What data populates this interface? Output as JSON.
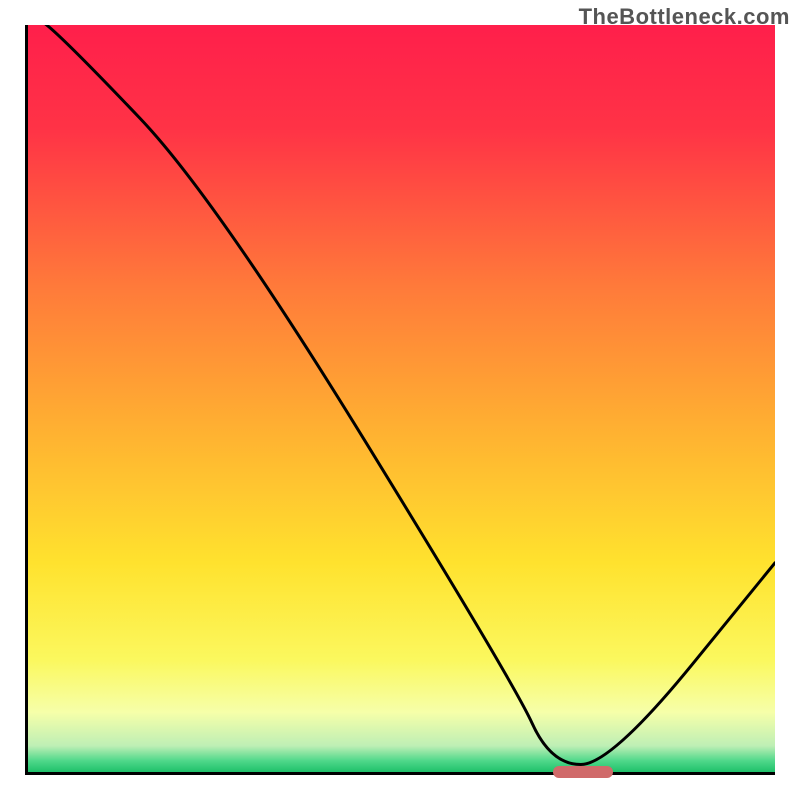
{
  "watermark": "TheBottleneck.com",
  "chart_data": {
    "type": "line",
    "title": "",
    "xlabel": "",
    "ylabel": "",
    "xlim": [
      0,
      100
    ],
    "ylim": [
      0,
      100
    ],
    "x": [
      0,
      5,
      25,
      65,
      70,
      78,
      100
    ],
    "values": [
      102,
      98,
      77,
      12,
      1,
      1,
      28
    ],
    "gradient_stops": [
      {
        "pos": 0.0,
        "color": "#ff1f4b"
      },
      {
        "pos": 0.14,
        "color": "#ff3346"
      },
      {
        "pos": 0.35,
        "color": "#ff7a3a"
      },
      {
        "pos": 0.55,
        "color": "#ffb331"
      },
      {
        "pos": 0.72,
        "color": "#ffe22e"
      },
      {
        "pos": 0.85,
        "color": "#fbf85e"
      },
      {
        "pos": 0.92,
        "color": "#f6ffa9"
      },
      {
        "pos": 0.965,
        "color": "#beefb5"
      },
      {
        "pos": 0.985,
        "color": "#4fd88a"
      },
      {
        "pos": 1.0,
        "color": "#1fc06a"
      }
    ],
    "marker": {
      "x_start": 70,
      "x_end": 78,
      "y": 0,
      "color": "#d06a6a"
    }
  }
}
